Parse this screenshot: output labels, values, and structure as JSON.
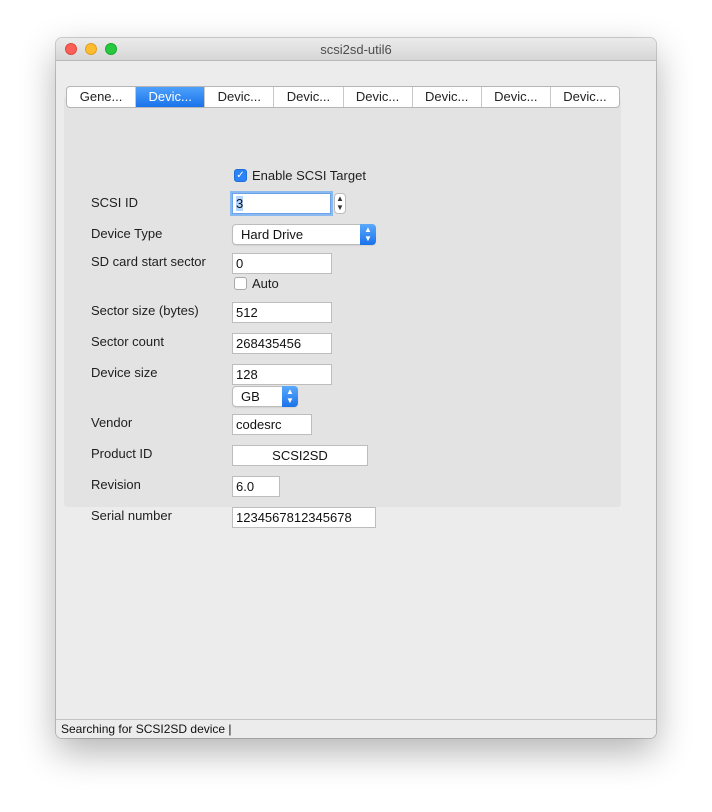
{
  "window": {
    "title": "scsi2sd-util6"
  },
  "tabs": [
    {
      "label": "Gene...",
      "active": false
    },
    {
      "label": "Devic...",
      "active": true
    },
    {
      "label": "Devic...",
      "active": false
    },
    {
      "label": "Devic...",
      "active": false
    },
    {
      "label": "Devic...",
      "active": false
    },
    {
      "label": "Devic...",
      "active": false
    },
    {
      "label": "Devic...",
      "active": false
    },
    {
      "label": "Devic...",
      "active": false
    }
  ],
  "form": {
    "enable_target": {
      "label": "Enable SCSI Target",
      "checked": true
    },
    "scsi_id": {
      "label": "SCSI ID",
      "value": "3"
    },
    "device_type": {
      "label": "Device Type",
      "value": "Hard Drive"
    },
    "sd_start": {
      "label": "SD card start sector",
      "value": "0"
    },
    "auto": {
      "label": "Auto",
      "checked": false
    },
    "sector_size": {
      "label": "Sector size (bytes)",
      "value": "512"
    },
    "sector_count": {
      "label": "Sector count",
      "value": "268435456"
    },
    "device_size": {
      "label": "Device size",
      "value": "128",
      "unit": "GB"
    },
    "vendor": {
      "label": "Vendor",
      "value": "codesrc"
    },
    "product_id": {
      "label": "Product ID",
      "value": "SCSI2SD"
    },
    "revision": {
      "label": "Revision",
      "value": "6.0"
    },
    "serial": {
      "label": "Serial number",
      "value": "1234567812345678"
    }
  },
  "status": {
    "text": "Searching for SCSI2SD device |"
  },
  "colors": {
    "accent": "#2a84f7",
    "checkbox": "#2a84f7"
  }
}
